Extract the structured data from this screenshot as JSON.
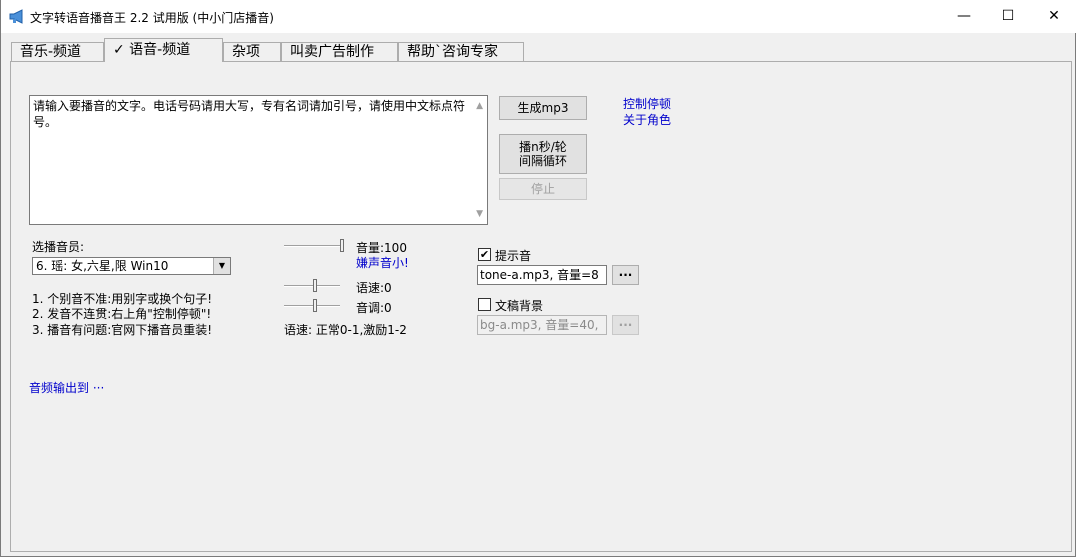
{
  "window": {
    "title": "文字转语音播音王 2.2 试用版  (中小门店播音)",
    "controls": {
      "minimize": "—",
      "maximize": "☐",
      "close": "✕"
    }
  },
  "tabs": [
    {
      "label": "音乐-频道"
    },
    {
      "label": "✓ 语音-频道"
    },
    {
      "label": "杂项"
    },
    {
      "label": "叫卖广告制作"
    },
    {
      "label": "帮助`咨询专家"
    }
  ],
  "main": {
    "text_input": {
      "value": "请输入要播音的文字。电话号码请用大写，专有名词请加引号，请使用中文标点符号。"
    },
    "buttons": {
      "generate_mp3": "生成mp3",
      "loop_play": "播n秒/轮\n间隔循环",
      "stop": "停止"
    },
    "links": {
      "control_pause": "控制停顿",
      "about_roles": "关于角色",
      "noise_small": "嫌声音小!",
      "audio_output": "音频输出到 ···"
    },
    "announcer": {
      "label": "选播音员:",
      "selected": "6. 瑶: 女,六星,限 Win10"
    },
    "tips": [
      "1. 个别音不准:用别字或换个句子!",
      "2. 发音不连贯:右上角\"控制停顿\"!",
      "3. 播音有问题:官网下播音员重装!"
    ],
    "sliders": {
      "volume_label": "音量:100",
      "speed_label": "语速:0",
      "pitch_label": "音调:0",
      "volume_level": 1.0,
      "speed_level": 0.55,
      "pitch_level": 0.55,
      "speed_note": "语速: 正常0-1,激励1-2"
    },
    "prompt_tone": {
      "label": "提示音",
      "checked": true,
      "file": "tone-a.mp3, 音量=8",
      "browse": "···"
    },
    "background": {
      "label": "文稿背景",
      "checked": false,
      "file": "bg-a.mp3, 音量=40,",
      "browse": "···"
    }
  }
}
